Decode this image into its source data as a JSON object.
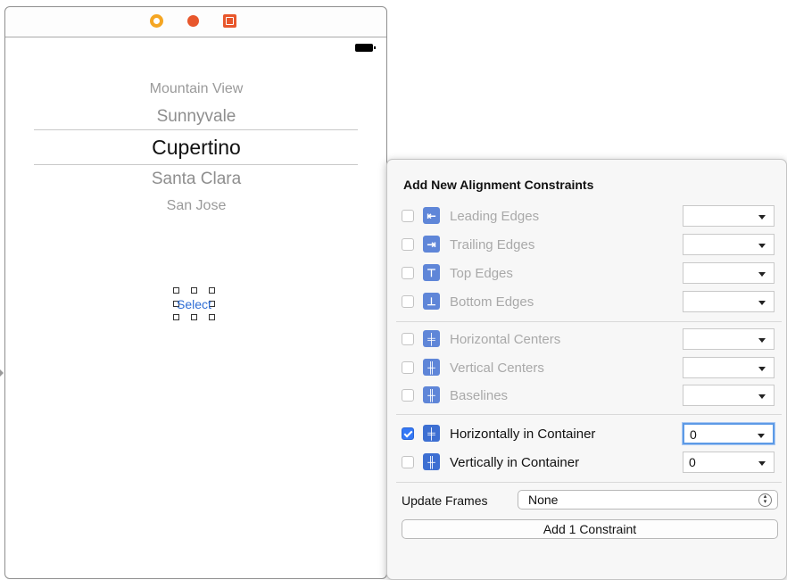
{
  "scene": {
    "dock_icons": [
      "view-controller-icon",
      "first-responder-icon",
      "exit-icon"
    ],
    "picker_items": [
      "Mountain View",
      "Sunnyvale",
      "Cupertino",
      "Santa Clara",
      "San Jose"
    ],
    "selected_index": 2,
    "button_label": "Select"
  },
  "popover": {
    "title": "Add New Alignment Constraints",
    "rows": [
      {
        "label": "Leading Edges",
        "checked": false,
        "enabled": false,
        "value": "",
        "icon": "leading-edges-icon"
      },
      {
        "label": "Trailing Edges",
        "checked": false,
        "enabled": false,
        "value": "",
        "icon": "trailing-edges-icon"
      },
      {
        "label": "Top Edges",
        "checked": false,
        "enabled": false,
        "value": "",
        "icon": "top-edges-icon"
      },
      {
        "label": "Bottom Edges",
        "checked": false,
        "enabled": false,
        "value": "",
        "icon": "bottom-edges-icon"
      },
      {
        "label": "Horizontal Centers",
        "checked": false,
        "enabled": false,
        "value": "",
        "icon": "horizontal-centers-icon"
      },
      {
        "label": "Vertical Centers",
        "checked": false,
        "enabled": false,
        "value": "",
        "icon": "vertical-centers-icon"
      },
      {
        "label": "Baselines",
        "checked": false,
        "enabled": false,
        "value": "",
        "icon": "baselines-icon"
      },
      {
        "label": "Horizontally in Container",
        "checked": true,
        "enabled": true,
        "value": "0",
        "icon": "horizontally-in-container-icon"
      },
      {
        "label": "Vertically in Container",
        "checked": false,
        "enabled": true,
        "value": "0",
        "icon": "vertically-in-container-icon"
      }
    ],
    "update_frames_label": "Update Frames",
    "update_frames_value": "None",
    "add_button_label": "Add 1 Constraint"
  },
  "colors": {
    "accent": "#3478f6",
    "constraint_icon": "#3d6fd2",
    "button_text": "#2f6ed6"
  }
}
